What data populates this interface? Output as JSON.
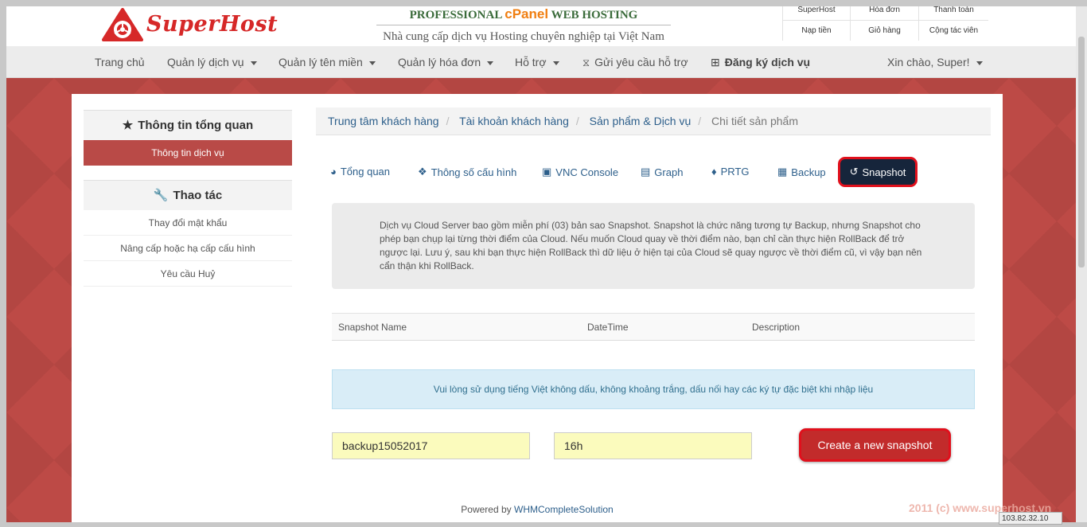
{
  "brand": {
    "name": "SuperHost",
    "accent": "#d62828"
  },
  "tagline": {
    "line1_pre": "PROFESSIONAL",
    "line1_cpanel": "cPanel",
    "line1_post": "WEB HOSTING",
    "line2": "Nhà cung cấp dịch vụ Hosting chuyên nghiệp tại Việt Nam"
  },
  "toplinks": [
    "SuperHost",
    "Hóa đơn",
    "Thanh toán",
    "Nạp tiền",
    "Giỏ hàng",
    "Cộng tác viên"
  ],
  "nav": {
    "items": [
      "Trang chủ",
      "Quản lý dịch vụ",
      "Quản lý tên miền",
      "Quản lý hóa đơn",
      "Hỗ trợ",
      "Gửi yêu cầu hỗ trợ",
      "Đăng ký dịch vụ"
    ],
    "greeting": "Xin chào, Super!"
  },
  "sidebar": {
    "overview_title": "Thông tin tổng quan",
    "overview_active": "Thông tin dịch vụ",
    "actions_title": "Thao tác",
    "actions": [
      "Thay đổi mật khẩu",
      "Nâng cấp hoặc hạ cấp cấu hình",
      "Yêu cầu Huỷ"
    ]
  },
  "breadcrumb": [
    "Trung tâm khách hàng",
    "Tài khoản khách hàng",
    "Sản phẩm & Dịch vụ",
    "Chi tiết sản phẩm"
  ],
  "tabs": [
    "Tổng quan",
    "Thông số cấu hình",
    "VNC Console",
    "Graph",
    "PRTG",
    "Backup",
    "Snapshot"
  ],
  "info_text": "Dịch vụ Cloud Server bao gồm miễn phí (03) bản sao Snapshot. Snapshot là chức năng tương tự Backup, nhưng Snapshot cho phép bạn chụp lại từng thời điểm của Cloud. Nếu muốn Cloud quay về thời điểm nào, bạn chỉ cần thực hiện RollBack để trở ngược lại. Lưu ý, sau khi bạn thực hiện RollBack thì dữ liệu ở hiện tại của Cloud sẽ quay ngược về thời điểm cũ, vì vậy bạn nên cẩn thận khi RollBack.",
  "table": {
    "headers": [
      "Snapshot Name",
      "DateTime",
      "Description"
    ]
  },
  "notice": "Vui lòng sử dụng tiếng Việt không dấu, không khoảng trắng, dấu nối hay các ký tự đặc biệt khi nhập liệu",
  "form": {
    "name_value": "backup15052017",
    "desc_value": "16h",
    "create_label": "Create a new snapshot"
  },
  "footer": {
    "powered_pre": "Powered by",
    "powered_link": "WHMCompleteSolution"
  },
  "watermark": "2011 (c) www.superhost.vn",
  "ip_text": "103.82.32.10"
}
